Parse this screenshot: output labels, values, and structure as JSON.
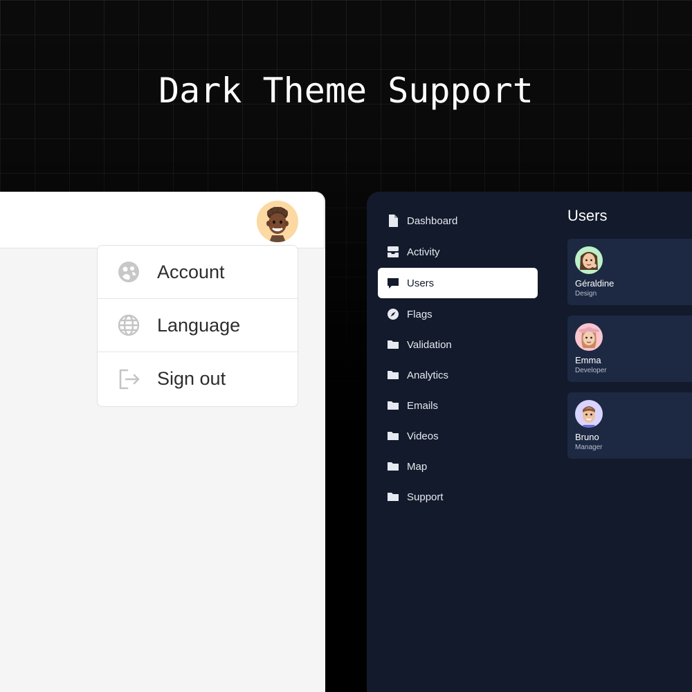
{
  "hero": {
    "title": "Dark Theme Support"
  },
  "colors": {
    "dark_panel_bg": "#121a2b",
    "user_card_bg": "#1d2942",
    "light_panel_bg": "#f5f5f5",
    "accent_white": "#ffffff"
  },
  "light_app": {
    "avatar": {
      "icon": "memoji-avatar-icon"
    },
    "menu": {
      "items": [
        {
          "label": "Account",
          "icon": "account-icon"
        },
        {
          "label": "Language",
          "icon": "globe-icon"
        },
        {
          "label": "Sign out",
          "icon": "sign-out-icon"
        }
      ]
    }
  },
  "dark_app": {
    "sidebar": {
      "items": [
        {
          "label": "Dashboard",
          "icon": "document-icon"
        },
        {
          "label": "Activity",
          "icon": "inbox-icon"
        },
        {
          "label": "Users",
          "icon": "chat-icon",
          "active": true
        },
        {
          "label": "Flags",
          "icon": "compass-icon"
        },
        {
          "label": "Validation",
          "icon": "folder-icon"
        },
        {
          "label": "Analytics",
          "icon": "folder-icon"
        },
        {
          "label": "Emails",
          "icon": "folder-icon"
        },
        {
          "label": "Videos",
          "icon": "folder-icon"
        },
        {
          "label": "Map",
          "icon": "folder-icon"
        },
        {
          "label": "Support",
          "icon": "folder-icon"
        }
      ]
    },
    "users": {
      "title": "Users",
      "list": [
        {
          "name": "Géraldine",
          "role": "Design",
          "avatar_color": "#bdf0c8"
        },
        {
          "name": "Emma",
          "role": "Developer",
          "avatar_color": "#f9c5cf"
        },
        {
          "name": "Bruno",
          "role": "Manager",
          "avatar_color": "#d9d4ff"
        }
      ]
    }
  }
}
